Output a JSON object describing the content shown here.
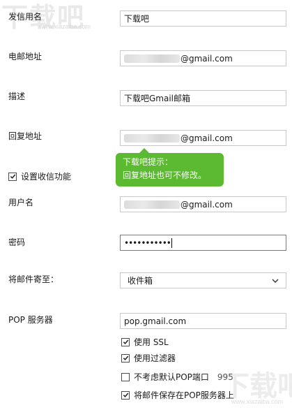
{
  "watermark": {
    "top_main": "下载吧",
    "top_url": "www.xiazaiba.com",
    "bottom_main": "下载吧",
    "bottom_url": "www.xiazaiba.com"
  },
  "form": {
    "sender_name": {
      "label": "发信用名",
      "value": "下载吧"
    },
    "email_address": {
      "label": "电邮地址",
      "value_suffix": "@gmail.com"
    },
    "description": {
      "label": "描述",
      "value": "下载吧Gmail邮箱"
    },
    "reply_address": {
      "label": "回复地址",
      "value_suffix": "@gmail.com"
    },
    "receive_setting": {
      "label": "设置收信功能",
      "checked": true
    },
    "username": {
      "label": "用户名",
      "value_suffix": "@gmail.com"
    },
    "password": {
      "label": "密码",
      "value": "•••••••••••"
    },
    "deliver_to": {
      "label": "将邮件寄至：",
      "selected": "收件箱"
    },
    "pop_server": {
      "label": "POP 服务器",
      "value": "pop.gmail.com"
    },
    "options": [
      {
        "label": "使用 SSL",
        "checked": true
      },
      {
        "label": "使用过滤器",
        "checked": true
      },
      {
        "label": "不考虑默认POP端口",
        "checked": false,
        "port": "995"
      },
      {
        "label": "将邮件保存在POP服务器上",
        "checked": true
      }
    ]
  },
  "tooltip": {
    "title": "下载吧提示：",
    "body": "回复地址也可不修改。"
  },
  "colors": {
    "tooltip_bg": "#5cb932",
    "border": "#c9c9c9"
  }
}
